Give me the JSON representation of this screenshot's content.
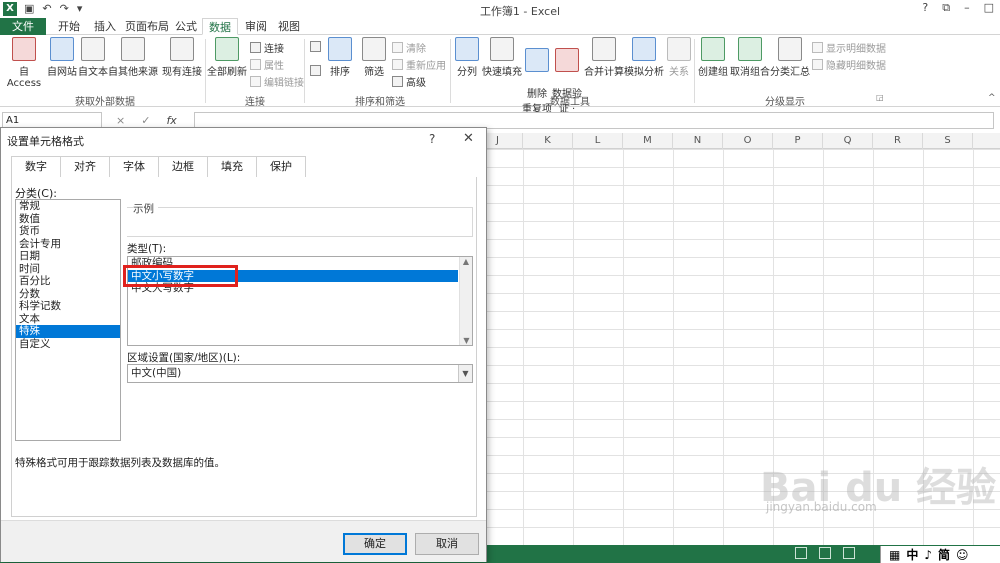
{
  "app": {
    "title": "工作簿1 - Excel",
    "logo": "X",
    "qat_icons": [
      "save-icon",
      "undo-icon",
      "redo-icon",
      "customize-icon"
    ],
    "win_controls": [
      "?",
      "⧉",
      "–",
      "□"
    ]
  },
  "ribbon_tabs": [
    "文件",
    "开始",
    "插入",
    "页面布局",
    "公式",
    "数据",
    "审阅",
    "视图"
  ],
  "active_tab": "数据",
  "ribbon": {
    "get_external": {
      "buttons": [
        "自 Access",
        "自网站",
        "自文本",
        "自其他来源",
        "现有连接"
      ],
      "label": "获取外部数据"
    },
    "connections": {
      "refresh": "全部刷新",
      "small": [
        "连接",
        "属性",
        "编辑链接"
      ],
      "label": "连接"
    },
    "sort_filter": {
      "sort": "排序",
      "filter": "筛选",
      "small": [
        "清除",
        "重新应用",
        "高级"
      ],
      "label": "排序和筛选"
    },
    "data_tools": {
      "buttons": [
        "分列",
        "快速填充",
        "删除\n重复项",
        "数据验\n证 ·",
        "合并计算",
        "模拟分析",
        "关系"
      ],
      "label": "数据工具"
    },
    "outline": {
      "buttons": [
        "创建组",
        "取消组合",
        "分类汇总"
      ],
      "small": [
        "显示明细数据",
        "隐藏明细数据"
      ],
      "label": "分级显示"
    }
  },
  "formula_bar": {
    "name_box": "A1",
    "fx": "fx",
    "cancel": "×",
    "confirm": "✓",
    "value": ""
  },
  "columns": [
    "J",
    "K",
    "L",
    "M",
    "N",
    "O",
    "P",
    "Q",
    "R",
    "S"
  ],
  "dialog": {
    "title": "设置单元格格式",
    "help": "?",
    "close": "✕",
    "tabs": [
      "数字",
      "对齐",
      "字体",
      "边框",
      "填充",
      "保护"
    ],
    "selected_tab": "数字",
    "category_label": "分类(C):",
    "categories": [
      "常规",
      "数值",
      "货币",
      "会计专用",
      "日期",
      "时间",
      "百分比",
      "分数",
      "科学记数",
      "文本",
      "特殊",
      "自定义"
    ],
    "selected_category": "特殊",
    "sample_label": "示例",
    "type_label": "类型(T):",
    "types": [
      "邮政编码",
      "中文小写数字",
      "中文大写数字"
    ],
    "selected_type": "中文小写数字",
    "locale_label": "区域设置(国家/地区)(L):",
    "locale_value": "中文(中国)",
    "description": "特殊格式可用于跟踪数据列表及数据库的值。",
    "ok": "确定",
    "cancel": "取消"
  },
  "status_bar": {
    "ime": [
      "中",
      "♪",
      "简",
      "☺"
    ]
  },
  "watermark": {
    "logo_text": "Bai du 经验",
    "url": "jingyan.baidu.com"
  },
  "colors": {
    "excel_green": "#217346",
    "selection_blue": "#0078d7",
    "highlight_red": "#e0211d"
  }
}
